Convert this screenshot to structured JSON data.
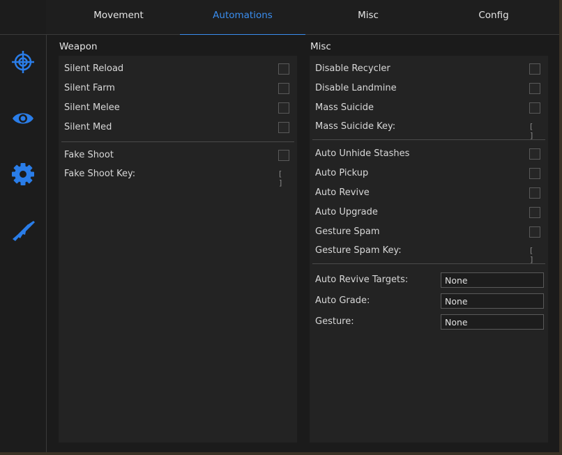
{
  "accent_color": "#3a8ef0",
  "tabs": [
    {
      "label": "Movement",
      "active": false
    },
    {
      "label": "Automations",
      "active": true
    },
    {
      "label": "Misc",
      "active": false
    },
    {
      "label": "Config",
      "active": false
    }
  ],
  "sidebar": {
    "icons": [
      "crosshair-icon",
      "eye-icon",
      "gear-icon",
      "rifle-icon"
    ]
  },
  "weapon": {
    "title": "Weapon",
    "silent_reload": "Silent Reload",
    "silent_farm": "Silent Farm",
    "silent_melee": "Silent Melee",
    "silent_med": "Silent Med",
    "fake_shoot": "Fake Shoot",
    "fake_shoot_key": "Fake Shoot Key:",
    "fake_shoot_key_value": "[ ]"
  },
  "misc": {
    "title": "Misc",
    "disable_recycler": "Disable Recycler",
    "disable_landmine": "Disable Landmine",
    "mass_suicide": "Mass Suicide",
    "mass_suicide_key": "Mass Suicide Key:",
    "mass_suicide_key_value": "[ ]",
    "auto_unhide_stashes": "Auto Unhide Stashes",
    "auto_pickup": "Auto Pickup",
    "auto_revive": "Auto Revive",
    "auto_upgrade": "Auto Upgrade",
    "gesture_spam": "Gesture Spam",
    "gesture_spam_key": "Gesture Spam Key:",
    "gesture_spam_key_value": "[ ]",
    "auto_revive_targets": "Auto Revive Targets:",
    "auto_revive_targets_value": "None",
    "auto_grade": "Auto Grade:",
    "auto_grade_value": "None",
    "gesture": "Gesture:",
    "gesture_value": "None"
  }
}
